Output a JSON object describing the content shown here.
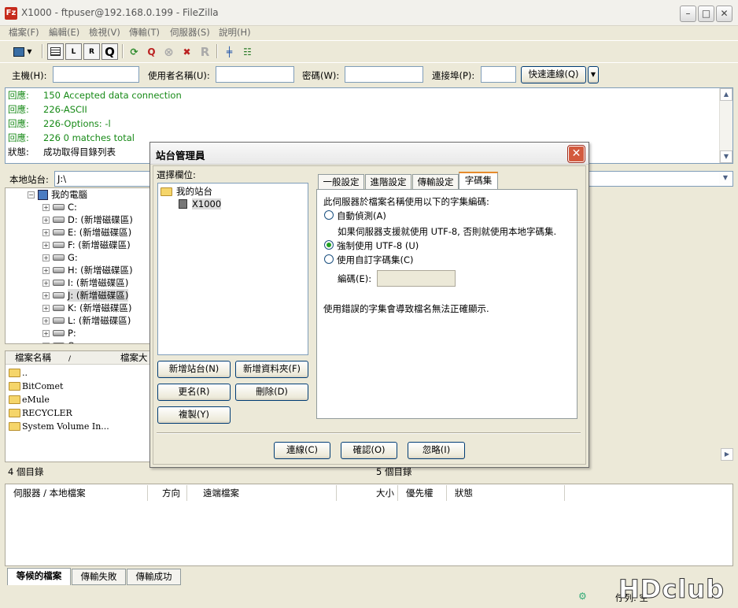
{
  "window": {
    "title": "X1000 - ftpuser@192.168.0.199 - FileZilla",
    "app_icon": "Fz"
  },
  "menu": [
    "檔案(F)",
    "編輯(E)",
    "檢視(V)",
    "傳輸(T)",
    "伺服器(S)",
    "說明(H)"
  ],
  "quickconnect": {
    "host_label": "主機(H):",
    "user_label": "使用者名稱(U):",
    "pass_label": "密碼(W):",
    "port_label": "連接埠(P):",
    "button": "快速連線(Q)"
  },
  "log": [
    {
      "label": "回應:",
      "text": "150 Accepted data connection",
      "color": "#178a17"
    },
    {
      "label": "回應:",
      "text": "226-ASCII",
      "color": "#178a17"
    },
    {
      "label": "回應:",
      "text": "226-Options: -l",
      "color": "#178a17"
    },
    {
      "label": "回應:",
      "text": "226 0 matches total",
      "color": "#178a17"
    },
    {
      "label": "狀態:",
      "text": "成功取得目錄列表",
      "color": "#000000"
    }
  ],
  "local": {
    "label": "本地站台:",
    "path": "J:\\",
    "tree_root": "我的電腦",
    "drives": [
      "C:",
      "D: (新增磁碟區)",
      "E: (新增磁碟區)",
      "F: (新增磁碟區)",
      "G:",
      "H: (新增磁碟區)",
      "I: (新增磁碟區)",
      "J: (新增磁碟區)",
      "K: (新增磁碟區)",
      "L: (新增磁碟區)",
      "P:",
      "Q:"
    ],
    "col_name": "檔案名稱",
    "col_sort": "/",
    "col_size": "檔案大",
    "files": [
      "..",
      "BitComet",
      "eMule",
      "RECYCLER",
      "System Volume In..."
    ],
    "status": "4 個目錄"
  },
  "remote": {
    "status": "5 個目錄"
  },
  "queue": {
    "headers": [
      "伺服器 / 本地檔案",
      "方向",
      "遠端檔案",
      "大小",
      "優先權",
      "狀態"
    ],
    "tabs": [
      "等候的檔案",
      "傳輸失敗",
      "傳輸成功"
    ]
  },
  "statusbar": {
    "text": "佇列: 空"
  },
  "watermark": "HDclub",
  "dialog": {
    "title": "站台管理員",
    "select_label": "選擇欄位:",
    "site_root": "我的站台",
    "site_item": "X1000",
    "tabs": [
      "一般設定",
      "進階設定",
      "傳輸設定",
      "字碼集"
    ],
    "charset": {
      "heading": "此伺服器於檔案名稱使用以下的字集編碼:",
      "opt_auto": "自動偵測(A)",
      "opt_auto_desc": "如果伺服器支援就使用 UTF-8, 否則就使用本地字碼集.",
      "opt_utf8": "強制使用 UTF-8 (U)",
      "opt_custom": "使用自訂字碼集(C)",
      "encoding_label": "編碼(E):",
      "encoding_value": "",
      "warning": "使用錯誤的字集會導致檔名無法正確顯示."
    },
    "buttons": {
      "new_site": "新增站台(N)",
      "new_folder": "新增資料夾(F)",
      "rename": "更名(R)",
      "delete": "刪除(D)",
      "copy": "複製(Y)",
      "connect": "連線(C)",
      "ok": "確認(O)",
      "cancel": "忽略(I)"
    }
  }
}
